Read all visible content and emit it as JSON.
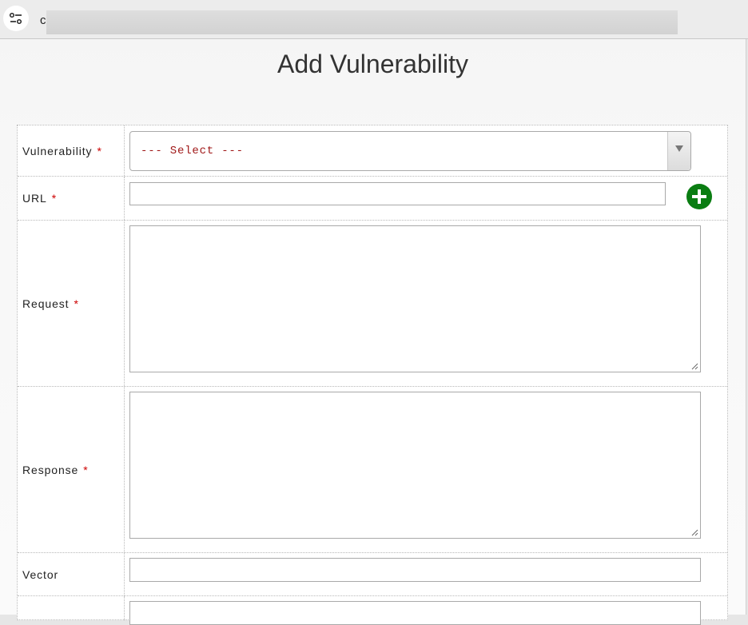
{
  "toolbar": {
    "settings_icon": "sliders-icon",
    "address_visible_text": "c"
  },
  "page": {
    "title": "Add Vulnerability"
  },
  "form": {
    "required_marker": "*",
    "vulnerability": {
      "label": "Vulnerability",
      "selected": "--- Select ---"
    },
    "url": {
      "label": "URL",
      "value": "",
      "add_icon": "plus-circle-icon"
    },
    "request": {
      "label": "Request",
      "value": ""
    },
    "response": {
      "label": "Response",
      "value": ""
    },
    "vector": {
      "label": "Vector",
      "value": ""
    }
  },
  "colors": {
    "required": "#cc0000",
    "select_text": "#a01818",
    "add_button": "#0a7d12"
  }
}
